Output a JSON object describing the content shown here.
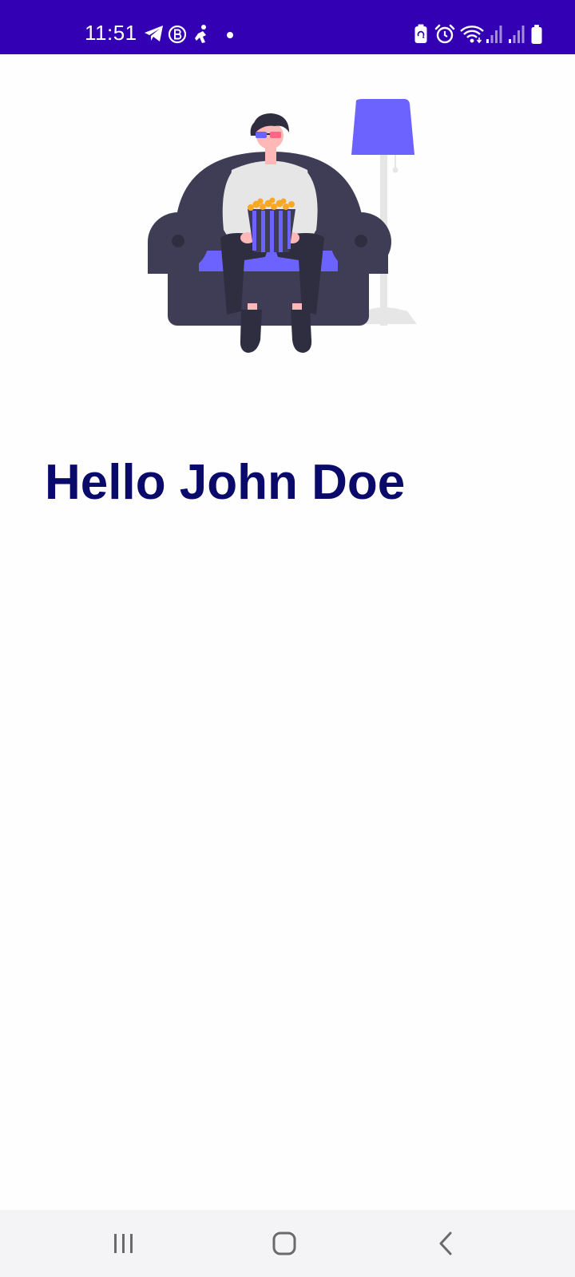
{
  "status_bar": {
    "time": "11:51",
    "notification_icons": [
      "telegram-icon",
      "b-app-icon",
      "accessibility-icon",
      "dot-icon"
    ],
    "system_icons": [
      "battery-saver-icon",
      "alarm-icon",
      "wifi-icon",
      "signal-icon",
      "signal-icon",
      "battery-icon"
    ],
    "background_color": "#3400b4"
  },
  "illustration": {
    "icon": "person-on-armchair-with-popcorn-illustration",
    "accent_color": "#6c63ff"
  },
  "main": {
    "greeting": "Hello John Doe",
    "greeting_color": "#0a0a6a"
  },
  "nav_bar": {
    "buttons": [
      "recents-button",
      "home-button",
      "back-button"
    ]
  }
}
